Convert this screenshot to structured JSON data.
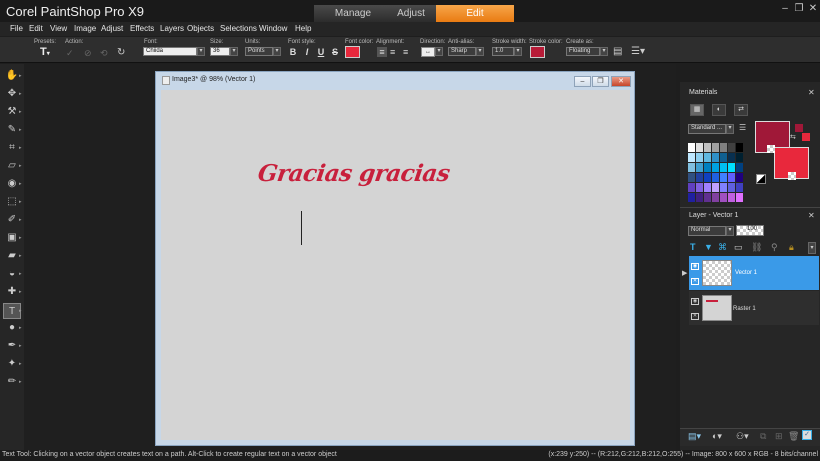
{
  "app": {
    "title": "Corel PaintShop Pro X9"
  },
  "workspace_tabs": [
    "Manage",
    "Adjust",
    "Edit"
  ],
  "window_controls": {
    "minimize": "–",
    "restore": "❐",
    "close": "✕"
  },
  "menu": [
    "File",
    "Edit",
    "View",
    "Image",
    "Adjust",
    "Effects",
    "Layers",
    "Objects",
    "Selections",
    "Window",
    "Help"
  ],
  "tool_options": {
    "presets_label": "Presets:",
    "actions_label": "Action:",
    "font_label": "Font:",
    "font_value": "Chiida",
    "size_label": "Size:",
    "size_value": "36",
    "units_label": "Units:",
    "units_value": "Points",
    "style_label": "Font style:",
    "style_buttons": [
      "B",
      "I",
      "U",
      "S"
    ],
    "font_color_label": "Font color:",
    "font_color": "#e8283c",
    "alignment_label": "Alignment:",
    "direction_label": "Direction:",
    "antialias_label": "Anti-alias:",
    "antialias_value": "Sharp",
    "stroke_width_label": "Stroke width:",
    "stroke_width_value": "1.0",
    "stroke_color_label": "Stroke color:",
    "stroke_color": "#b81c38",
    "create_as_label": "Create as:",
    "create_as_value": "Floating"
  },
  "tools": [
    {
      "name": "pan-tool",
      "icon": "✋"
    },
    {
      "name": "move-tool",
      "icon": "✥"
    },
    {
      "name": "pick-tool",
      "icon": "⚒"
    },
    {
      "name": "dropper-tool",
      "icon": "✎"
    },
    {
      "name": "crop-tool",
      "icon": "⌗"
    },
    {
      "name": "straighten-tool",
      "icon": "▱"
    },
    {
      "name": "red-eye-tool",
      "icon": "◉"
    },
    {
      "name": "selection-tool",
      "icon": "⬚"
    },
    {
      "name": "brush-tool",
      "icon": "✐"
    },
    {
      "name": "gradient-tool",
      "icon": "▣"
    },
    {
      "name": "eraser-tool",
      "icon": "▰"
    },
    {
      "name": "fill-tool",
      "icon": "◒"
    },
    {
      "name": "color-replacer-tool",
      "icon": "✚"
    },
    {
      "name": "text-tool",
      "icon": "T"
    },
    {
      "name": "ellipse-tool",
      "icon": "●"
    },
    {
      "name": "pen-tool",
      "icon": "✒"
    },
    {
      "name": "picture-tube-tool",
      "icon": "✦"
    },
    {
      "name": "art-media-tool",
      "icon": "✏"
    }
  ],
  "document": {
    "title": "Image3* @  98% (Vector 1)",
    "canvas_text": "Gracias gracias",
    "canvas_color": "#d4d4d4",
    "text_color": "#c8203c"
  },
  "materials": {
    "title": "Materials",
    "palette_select": "Standard ...",
    "foreground_color": "#a01838",
    "background_color": "#e8283c"
  },
  "layers": {
    "title": "Layer - Vector 1",
    "blend_mode": "Normal",
    "opacity": "100",
    "items": [
      {
        "name": "Vector 1",
        "selected": true
      },
      {
        "name": "Raster 1",
        "selected": false
      }
    ]
  },
  "status": {
    "hint": "Text Tool: Clicking on a vector object creates text on a path. Alt-Click to create regular text on a vector object",
    "info": "(x:239 y:250) -- (R:212,G:212,B:212,O:255) -- Image:  800 x 600 x RGB - 8 bits/channel"
  }
}
